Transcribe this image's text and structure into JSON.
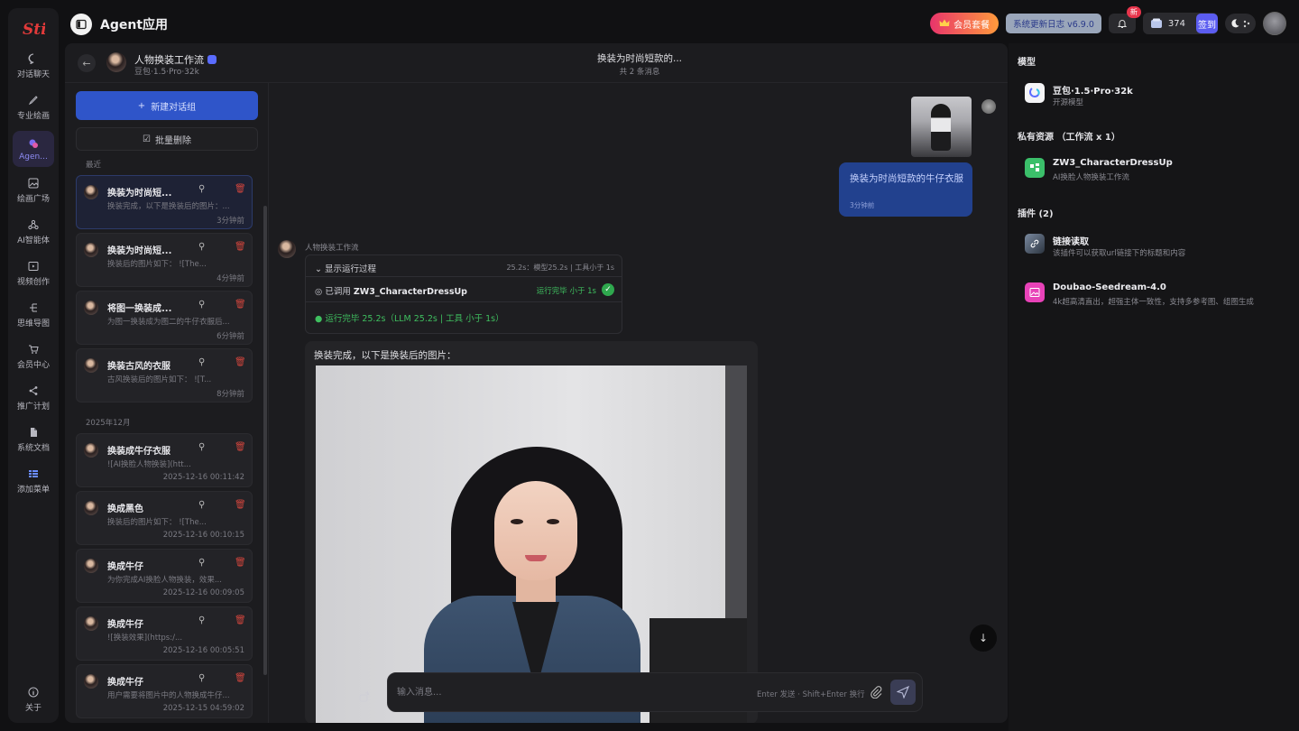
{
  "rail": {
    "logo": "Sti",
    "items": [
      {
        "label": "对话聊天",
        "icon": "chat-icon"
      },
      {
        "label": "专业绘画",
        "icon": "brush-icon"
      },
      {
        "label": "Agen...",
        "icon": "agent-icon"
      },
      {
        "label": "绘画广场",
        "icon": "gallery-icon"
      },
      {
        "label": "AI智能体",
        "icon": "network-icon"
      },
      {
        "label": "视频创作",
        "icon": "video-icon"
      },
      {
        "label": "思维导图",
        "icon": "mindmap-icon"
      },
      {
        "label": "会员中心",
        "icon": "cart-icon"
      },
      {
        "label": "推广计划",
        "icon": "share-icon"
      },
      {
        "label": "系统文档",
        "icon": "doc-icon"
      },
      {
        "label": "添加菜单",
        "icon": "menu-icon"
      }
    ],
    "about": "关于"
  },
  "topbar": {
    "title": "Agent应用",
    "vip_label": "会员套餐",
    "changelog_label": "系统更新日志 v6.9.0",
    "bell_badge": "新",
    "credits": "374",
    "sign_label": "签到"
  },
  "chat_header": {
    "agent_name": "人物换装工作流",
    "agent_model": "豆包·1.5·Pro·32k",
    "conversation_title": "换装为时尚短款的...",
    "message_count": "共 2 条消息"
  },
  "sidebar": {
    "new_label": "新建对话组",
    "batch_delete_label": "批量删除",
    "groups": [
      {
        "label": "最近",
        "items": [
          {
            "title": "换装为时尚短...",
            "subtitle": "换装完成，以下是换装后的图片：...",
            "time": "3分钟前",
            "active": true
          },
          {
            "title": "换装为时尚短...",
            "subtitle": "换装后的图片如下： ![The...",
            "time": "4分钟前"
          },
          {
            "title": "将图一换装成...",
            "subtitle": "为图一换装成为图二的牛仔衣服后...",
            "time": "6分钟前"
          },
          {
            "title": "换装古风的衣服",
            "subtitle": "古风换装后的图片如下： ![T...",
            "time": "8分钟前"
          }
        ]
      },
      {
        "label": "2025年12月",
        "items": [
          {
            "title": "换装成牛仔衣服",
            "subtitle": "![AI换脸人物换装](htt...",
            "time": "2025-12-16 00:11:42"
          },
          {
            "title": "换成黑色",
            "subtitle": "换装后的图片如下： ![The...",
            "time": "2025-12-16 00:10:15"
          },
          {
            "title": "换成牛仔",
            "subtitle": "为你完成AI换脸人物换装，效果...",
            "time": "2025-12-16 00:09:05"
          },
          {
            "title": "换成牛仔",
            "subtitle": "![换装效果](https:/...",
            "time": "2025-12-16 00:05:51"
          },
          {
            "title": "换成牛仔",
            "subtitle": "用户需要将图片中的人物换成牛仔...",
            "time": "2025-12-15 04:59:02"
          }
        ]
      }
    ]
  },
  "chat": {
    "user_message": "换装为时尚短款的牛仔衣服",
    "user_time": "3分钟前",
    "bot_name": "人物换装工作流",
    "process_toggle": "显示运行过程",
    "process_stats": "25.2s：模型25.2s | 工具小于 1s",
    "call_prefix": "已调用",
    "call_tool": "ZW3_CharacterDressUp",
    "call_status": "运行完毕 小于 1s",
    "run_summary": "运行完毕 25.2s（LLM 25.2s | 工具 小于 1s）",
    "bot_message": "换装完成，以下是换装后的图片：",
    "input_placeholder": "输入消息...",
    "input_hint": "Enter 发送 · Shift+Enter 换行"
  },
  "right_panel": {
    "model_heading": "模型",
    "model": {
      "name": "豆包·1.5·Pro·32k",
      "desc": "开源模型"
    },
    "private_heading": "私有资源 （工作流 x 1）",
    "workflow": {
      "name": "ZW3_CharacterDressUp",
      "desc": "AI换脸人物换装工作流"
    },
    "plugins_heading": "插件 (2)",
    "plugins": [
      {
        "name": "链接读取",
        "desc": "该插件可以获取url链接下的标题和内容"
      },
      {
        "name": "Doubao-Seedream-4.0",
        "desc": "4k超高清直出，超强主体一致性，支持多参考图、组图生成"
      }
    ]
  },
  "colors": {
    "accent": "#5b5cf0",
    "new_button": "#2f55c9",
    "user_bubble": "#22418e",
    "success": "#3fbf5f",
    "danger": "#d0453d"
  }
}
